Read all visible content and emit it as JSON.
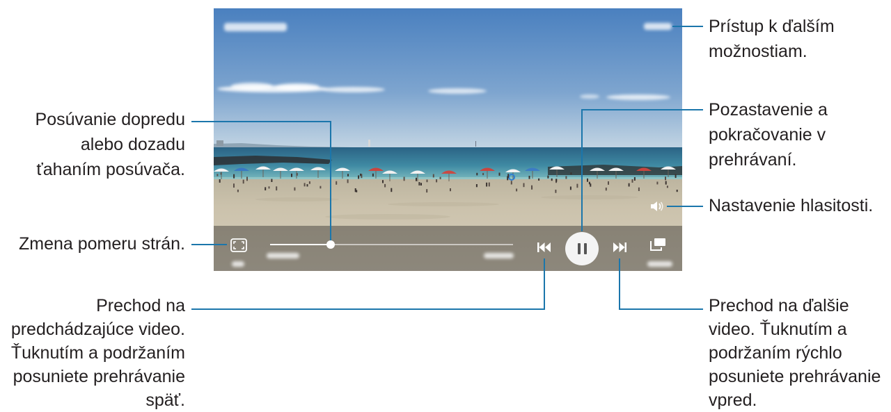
{
  "video_player": {
    "progress_fraction": 0.25,
    "controls": {
      "aspect_ratio": {
        "icon": "aspect-ratio-icon"
      },
      "previous": {
        "icon": "skip-previous-icon"
      },
      "play_pause": {
        "icon": "pause-icon"
      },
      "next": {
        "icon": "skip-next-icon"
      },
      "popup_player": {
        "icon": "popup-player-icon"
      },
      "volume": {
        "icon": "volume-icon"
      }
    }
  },
  "callouts": {
    "more_options": "Prístup k ďalším\nmožnostiam.",
    "seek": "Posúvanie dopredu\nalebo dozadu\nťahaním posúvača.",
    "pause_resume": "Pozastavenie a\npokračovanie v\nprehrávaní.",
    "volume": "Nastavenie hlasitosti.",
    "aspect_ratio": "Zmena pomeru strán.",
    "previous": "Prechod na\npredchádzajúce video.\nŤuknutím a podržaním\nposuniete prehrávanie\nspäť.",
    "next": "Prechod na ďalšie\nvideo. Ťuknutím a\npodržaním rýchlo\nposuniete prehrávanie\nvpred."
  },
  "colors": {
    "callout_line": "#1b76ab",
    "callout_text": "#231f20",
    "pause_button": "#f4f4f4"
  }
}
